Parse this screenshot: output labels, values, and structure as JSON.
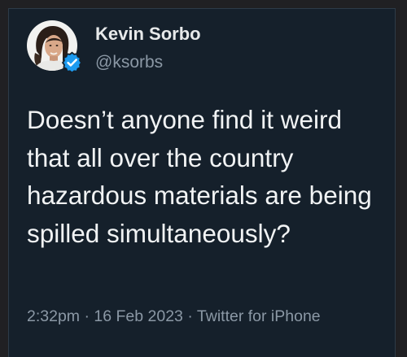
{
  "tweet": {
    "author_name": "Kevin Sorbo",
    "author_handle": "@ksorbs",
    "verified": true,
    "avatar": "profile-photo",
    "text": "Doesn’t anyone find it weird that all over the country hazardous materials are being spilled simultaneously?",
    "time": "2:32pm",
    "separator_1": "·",
    "date": "16 Feb 2023",
    "separator_2": "·",
    "source": "Twitter for iPhone"
  },
  "colors": {
    "card_background": "#15202b",
    "outer_background": "#202023",
    "primary_text": "#e7e9ea",
    "secondary_text": "#8b98a5",
    "verified_badge": "#1d9bf0"
  }
}
